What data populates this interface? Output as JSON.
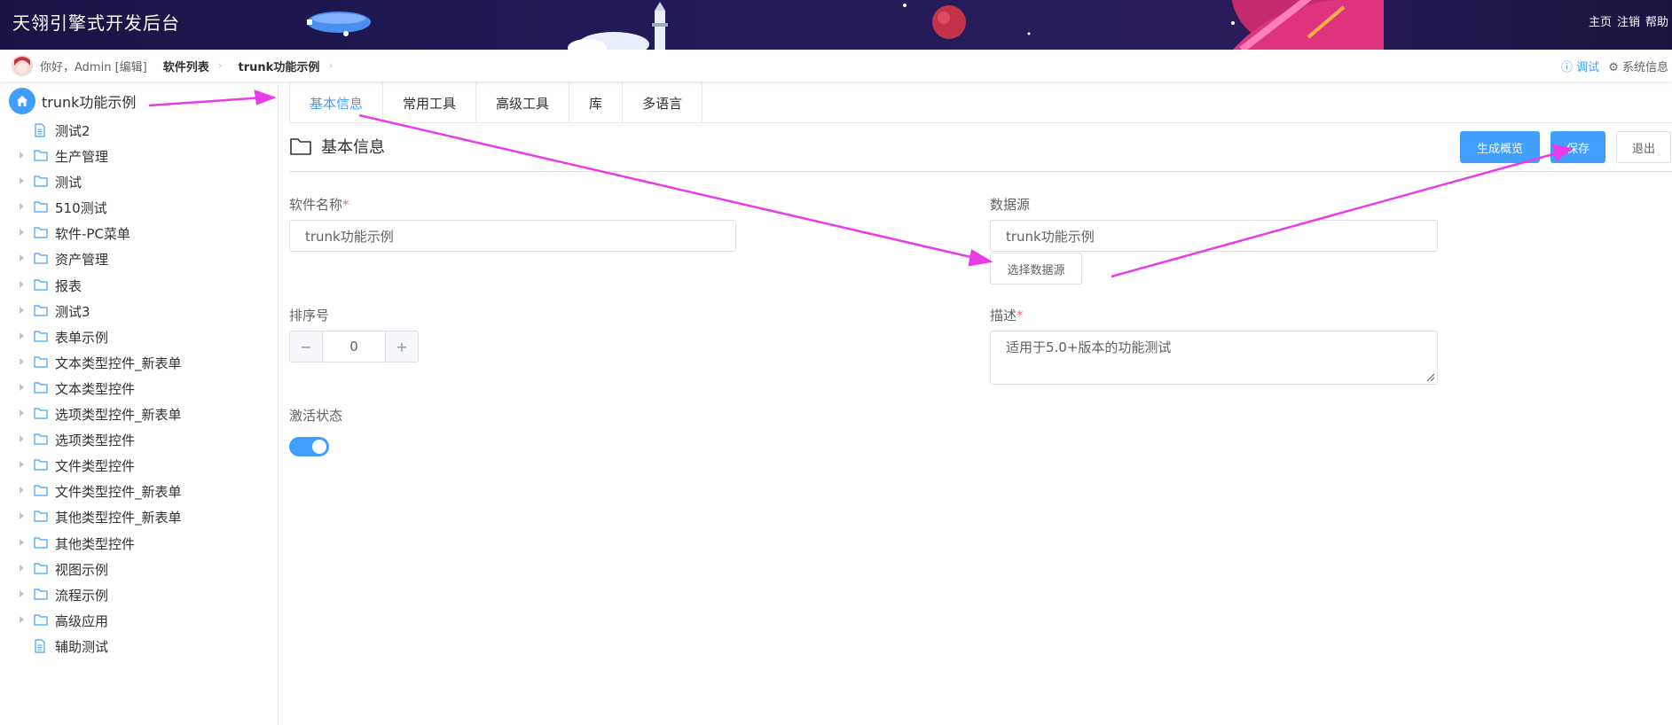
{
  "header": {
    "title": "天翎引擎式开发后台",
    "links": [
      "主页",
      "注销",
      "帮助"
    ],
    "background_color": "#1a1446"
  },
  "subbar": {
    "greeting": "你好，Admin [编辑]",
    "breadcrumbs": [
      "软件列表",
      "trunk功能示例"
    ],
    "debug_label": "调试",
    "sysinfo_label": "系统信息"
  },
  "sidebar": {
    "root": {
      "label": "trunk功能示例",
      "icon": "home-icon"
    },
    "items": [
      {
        "label": "测试2",
        "icon": "document-icon",
        "expandable": false
      },
      {
        "label": "生产管理",
        "icon": "folder-icon",
        "expandable": true
      },
      {
        "label": "测试",
        "icon": "folder-icon",
        "expandable": true
      },
      {
        "label": "510测试",
        "icon": "folder-icon",
        "expandable": true
      },
      {
        "label": "软件-PC菜单",
        "icon": "folder-icon",
        "expandable": true
      },
      {
        "label": "资产管理",
        "icon": "folder-icon",
        "expandable": true
      },
      {
        "label": "报表",
        "icon": "folder-icon",
        "expandable": true
      },
      {
        "label": "测试3",
        "icon": "folder-icon",
        "expandable": true
      },
      {
        "label": "表单示例",
        "icon": "folder-icon",
        "expandable": true
      },
      {
        "label": "文本类型控件_新表单",
        "icon": "folder-icon",
        "expandable": true
      },
      {
        "label": "文本类型控件",
        "icon": "folder-icon",
        "expandable": true
      },
      {
        "label": "选项类型控件_新表单",
        "icon": "folder-icon",
        "expandable": true
      },
      {
        "label": "选项类型控件",
        "icon": "folder-icon",
        "expandable": true
      },
      {
        "label": "文件类型控件",
        "icon": "folder-icon",
        "expandable": true
      },
      {
        "label": "文件类型控件_新表单",
        "icon": "folder-icon",
        "expandable": true
      },
      {
        "label": "其他类型控件_新表单",
        "icon": "folder-icon",
        "expandable": true
      },
      {
        "label": "其他类型控件",
        "icon": "folder-icon",
        "expandable": true
      },
      {
        "label": "视图示例",
        "icon": "folder-icon",
        "expandable": true
      },
      {
        "label": "流程示例",
        "icon": "folder-icon",
        "expandable": true
      },
      {
        "label": "高级应用",
        "icon": "folder-icon",
        "expandable": true
      },
      {
        "label": "辅助测试",
        "icon": "document-icon",
        "expandable": false
      }
    ]
  },
  "tabs": [
    {
      "label": "基本信息",
      "active": true
    },
    {
      "label": "常用工具",
      "active": false
    },
    {
      "label": "高级工具",
      "active": false
    },
    {
      "label": "库",
      "active": false
    },
    {
      "label": "多语言",
      "active": false
    }
  ],
  "section": {
    "title": "基本信息",
    "buttons": {
      "preview": "生成概览",
      "save": "保存",
      "exit": "退出"
    }
  },
  "form": {
    "software_name": {
      "label": "软件名称",
      "required_mark": "*",
      "value": "trunk功能示例"
    },
    "data_source": {
      "label": "数据源",
      "value": "trunk功能示例",
      "button": "选择数据源"
    },
    "sort_order": {
      "label": "排序号",
      "value": "0",
      "minus": "−",
      "plus": "+"
    },
    "description": {
      "label": "描述",
      "required_mark": "*",
      "value": "适用于5.0+版本的功能测试"
    },
    "active_status": {
      "label": "激活状态",
      "enabled": true
    }
  },
  "colors": {
    "accent": "#409eff",
    "annotation_arrow": "#e83ce8",
    "required": "#f56c6c"
  }
}
